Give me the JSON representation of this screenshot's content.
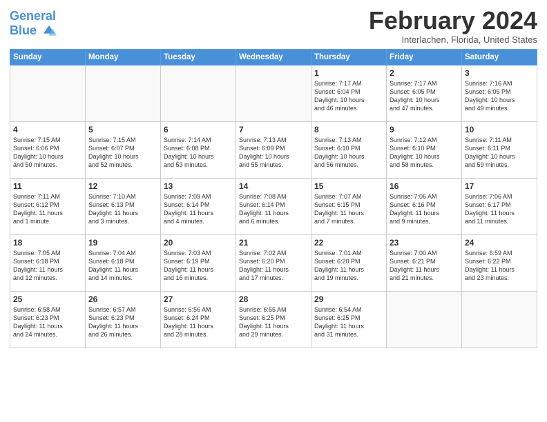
{
  "header": {
    "logo_line1": "General",
    "logo_line2": "Blue",
    "month_title": "February 2024",
    "location": "Interlachen, Florida, United States"
  },
  "days_of_week": [
    "Sunday",
    "Monday",
    "Tuesday",
    "Wednesday",
    "Thursday",
    "Friday",
    "Saturday"
  ],
  "weeks": [
    [
      {
        "day": "",
        "info": ""
      },
      {
        "day": "",
        "info": ""
      },
      {
        "day": "",
        "info": ""
      },
      {
        "day": "",
        "info": ""
      },
      {
        "day": "1",
        "info": "Sunrise: 7:17 AM\nSunset: 6:04 PM\nDaylight: 10 hours\nand 46 minutes."
      },
      {
        "day": "2",
        "info": "Sunrise: 7:17 AM\nSunset: 6:05 PM\nDaylight: 10 hours\nand 47 minutes."
      },
      {
        "day": "3",
        "info": "Sunrise: 7:16 AM\nSunset: 6:05 PM\nDaylight: 10 hours\nand 49 minutes."
      }
    ],
    [
      {
        "day": "4",
        "info": "Sunrise: 7:15 AM\nSunset: 6:06 PM\nDaylight: 10 hours\nand 50 minutes."
      },
      {
        "day": "5",
        "info": "Sunrise: 7:15 AM\nSunset: 6:07 PM\nDaylight: 10 hours\nand 52 minutes."
      },
      {
        "day": "6",
        "info": "Sunrise: 7:14 AM\nSunset: 6:08 PM\nDaylight: 10 hours\nand 53 minutes."
      },
      {
        "day": "7",
        "info": "Sunrise: 7:13 AM\nSunset: 6:09 PM\nDaylight: 10 hours\nand 55 minutes."
      },
      {
        "day": "8",
        "info": "Sunrise: 7:13 AM\nSunset: 6:10 PM\nDaylight: 10 hours\nand 56 minutes."
      },
      {
        "day": "9",
        "info": "Sunrise: 7:12 AM\nSunset: 6:10 PM\nDaylight: 10 hours\nand 58 minutes."
      },
      {
        "day": "10",
        "info": "Sunrise: 7:11 AM\nSunset: 6:11 PM\nDaylight: 10 hours\nand 59 minutes."
      }
    ],
    [
      {
        "day": "11",
        "info": "Sunrise: 7:11 AM\nSunset: 6:12 PM\nDaylight: 11 hours\nand 1 minute."
      },
      {
        "day": "12",
        "info": "Sunrise: 7:10 AM\nSunset: 6:13 PM\nDaylight: 11 hours\nand 3 minutes."
      },
      {
        "day": "13",
        "info": "Sunrise: 7:09 AM\nSunset: 6:14 PM\nDaylight: 11 hours\nand 4 minutes."
      },
      {
        "day": "14",
        "info": "Sunrise: 7:08 AM\nSunset: 6:14 PM\nDaylight: 11 hours\nand 6 minutes."
      },
      {
        "day": "15",
        "info": "Sunrise: 7:07 AM\nSunset: 6:15 PM\nDaylight: 11 hours\nand 7 minutes."
      },
      {
        "day": "16",
        "info": "Sunrise: 7:06 AM\nSunset: 6:16 PM\nDaylight: 11 hours\nand 9 minutes."
      },
      {
        "day": "17",
        "info": "Sunrise: 7:06 AM\nSunset: 6:17 PM\nDaylight: 11 hours\nand 11 minutes."
      }
    ],
    [
      {
        "day": "18",
        "info": "Sunrise: 7:05 AM\nSunset: 6:18 PM\nDaylight: 11 hours\nand 12 minutes."
      },
      {
        "day": "19",
        "info": "Sunrise: 7:04 AM\nSunset: 6:18 PM\nDaylight: 11 hours\nand 14 minutes."
      },
      {
        "day": "20",
        "info": "Sunrise: 7:03 AM\nSunset: 6:19 PM\nDaylight: 11 hours\nand 16 minutes."
      },
      {
        "day": "21",
        "info": "Sunrise: 7:02 AM\nSunset: 6:20 PM\nDaylight: 11 hours\nand 17 minutes."
      },
      {
        "day": "22",
        "info": "Sunrise: 7:01 AM\nSunset: 6:20 PM\nDaylight: 11 hours\nand 19 minutes."
      },
      {
        "day": "23",
        "info": "Sunrise: 7:00 AM\nSunset: 6:21 PM\nDaylight: 11 hours\nand 21 minutes."
      },
      {
        "day": "24",
        "info": "Sunrise: 6:59 AM\nSunset: 6:22 PM\nDaylight: 11 hours\nand 23 minutes."
      }
    ],
    [
      {
        "day": "25",
        "info": "Sunrise: 6:58 AM\nSunset: 6:23 PM\nDaylight: 11 hours\nand 24 minutes."
      },
      {
        "day": "26",
        "info": "Sunrise: 6:57 AM\nSunset: 6:23 PM\nDaylight: 11 hours\nand 26 minutes."
      },
      {
        "day": "27",
        "info": "Sunrise: 6:56 AM\nSunset: 6:24 PM\nDaylight: 11 hours\nand 28 minutes."
      },
      {
        "day": "28",
        "info": "Sunrise: 6:55 AM\nSunset: 6:25 PM\nDaylight: 11 hours\nand 29 minutes."
      },
      {
        "day": "29",
        "info": "Sunrise: 6:54 AM\nSunset: 6:25 PM\nDaylight: 11 hours\nand 31 minutes."
      },
      {
        "day": "",
        "info": ""
      },
      {
        "day": "",
        "info": ""
      }
    ]
  ]
}
